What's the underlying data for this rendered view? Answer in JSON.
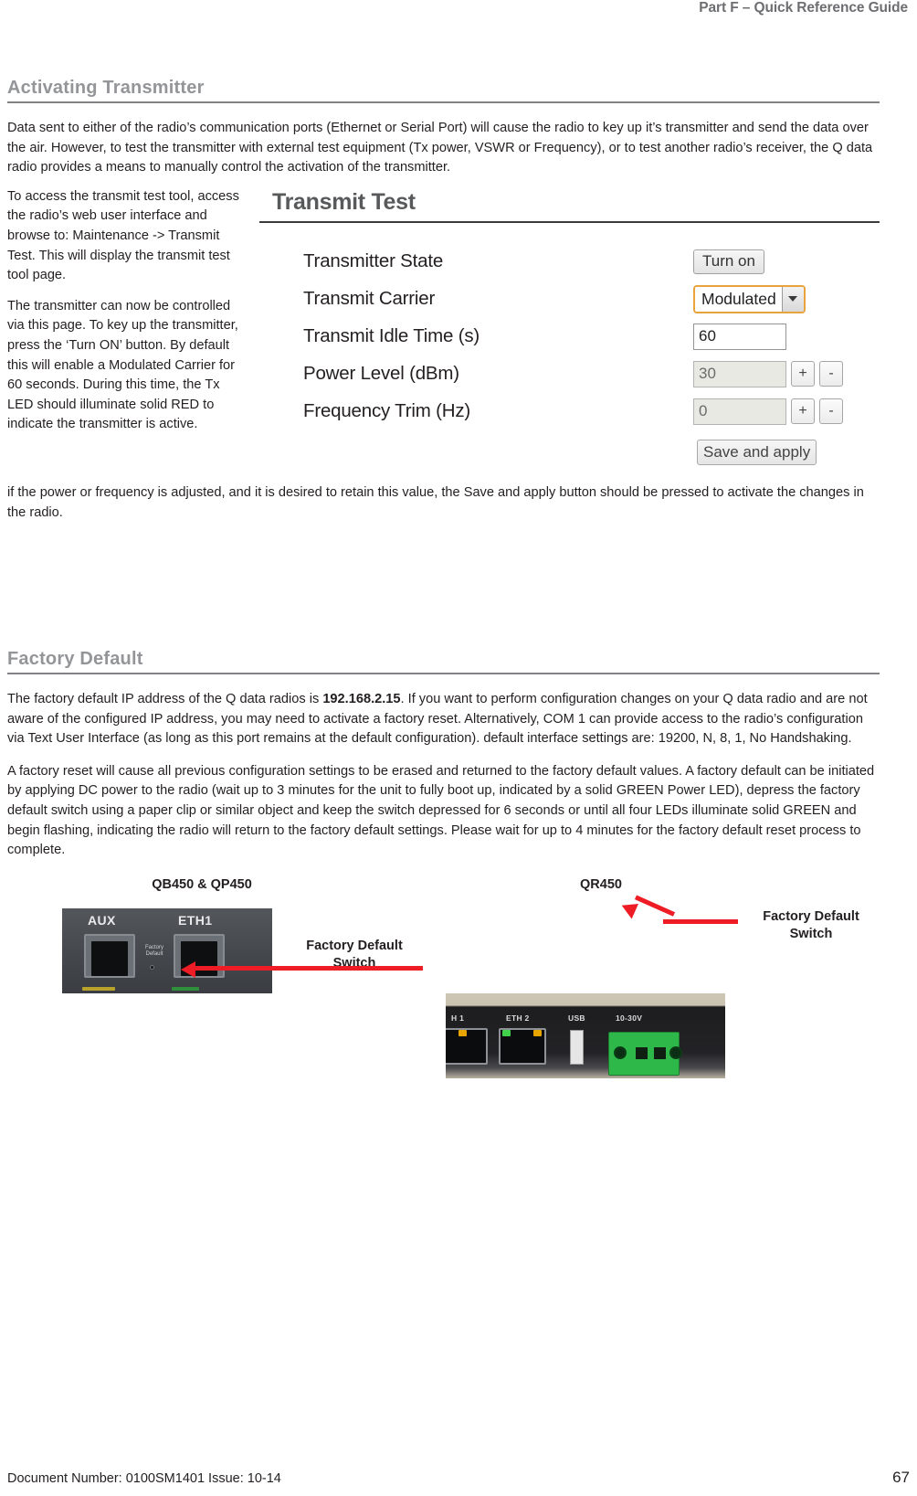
{
  "header": {
    "running_title": "Part F – Quick Reference Guide"
  },
  "sections": [
    {
      "title": "Activating Transmitter",
      "intro": "Data sent to either of the radio’s communication ports (Ethernet or Serial Port) will cause the radio to key up it’s transmitter and send the data over the air. However, to test the transmitter with external test equipment (Tx power, VSWR or Frequency), or to test another radio’s receiver, the Q data radio provides a means to manually control the activation of the transmitter.",
      "left_paragraphs": [
        "To access the transmit test tool, access the radio’s web user interface and browse to: Maintenance -> Transmit Test. This will display the transmit test tool page.",
        "The transmitter can now be controlled via this page. To key up the transmitter, press the ‘Turn ON’ button. By default this will enable a Modulated Carrier for 60 seconds. During this time, the Tx LED should illuminate solid RED to indicate the transmitter is active."
      ],
      "closing": "if the power or frequency is adjusted, and it is desired to retain this value, the Save and apply button should be pressed to activate the changes in the radio."
    },
    {
      "title": "Factory Default",
      "paragraphs": [
        {
          "before": "The factory default IP address of the Q data radios is ",
          "bold": "192.168.2.15",
          "after": ". If you want to perform configuration changes on your Q data radio and are not aware of the configured IP address, you may need to activate a factory reset. Alternatively, COM 1 can provide access to the radio’s configuration via Text User Interface (as long as this port remains at the default configuration). default interface settings are: 19200, N, 8, 1, No Handshaking."
        },
        {
          "before": "A factory reset will cause all previous configuration settings to be erased and returned to the factory default values. A factory default can be initiated by applying DC power to the radio (wait up to 3 minutes for the unit to fully boot up, indicated by a solid GREEN Power LED), depress the factory default switch using a paper clip or similar object and keep the switch depressed for 6 seconds or until all four LEDs illuminate solid GREEN and begin flashing, indicating the radio will return to the factory default settings. Please wait for up to 4 minutes for the factory default reset process to complete.",
          "bold": "",
          "after": ""
        }
      ]
    }
  ],
  "transmit_test": {
    "panel_title": "Transmit Test",
    "rows": [
      {
        "label": "Transmitter State",
        "control": "button",
        "value": "Turn on"
      },
      {
        "label": "Transmit Carrier",
        "control": "select",
        "value": "Modulated"
      },
      {
        "label": "Transmit Idle Time (s)",
        "control": "text",
        "value": "60"
      },
      {
        "label": "Power Level (dBm)",
        "control": "stepper",
        "value": "30"
      },
      {
        "label": "Frequency Trim (Hz)",
        "control": "stepper",
        "value": "0"
      }
    ],
    "plus_label": "+",
    "minus_label": "-",
    "save_label": "Save and apply",
    "accent_border": "#e8a33d"
  },
  "figures": {
    "left": {
      "caption": "QB450 & QP450",
      "annotation": "Factory Default\nSwitch",
      "photo_labels": {
        "aux": "AUX",
        "eth1": "ETH1",
        "tiny": "Factory\nDefault"
      }
    },
    "right": {
      "caption": "QR450",
      "annotation": "Factory Default\nSwitch",
      "photo_labels": {
        "eth1": "H 1",
        "eth2": "ETH 2",
        "usb": "USB",
        "power": "10-30V"
      }
    },
    "arrow_color": "#ee1c25"
  },
  "footer": {
    "document_number": "Document Number: 0100SM1401   Issue: 10-14",
    "page_number": "67"
  }
}
